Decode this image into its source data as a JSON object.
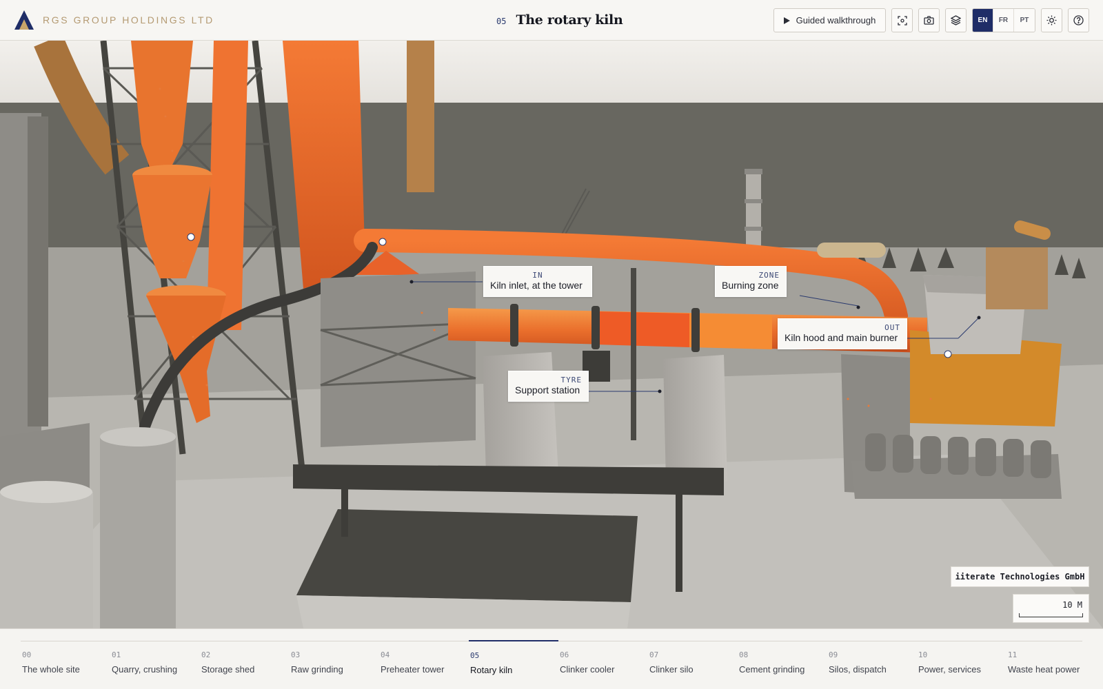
{
  "header": {
    "brand": "RGS GROUP HOLDINGS LTD",
    "section_number": "05",
    "title": "The rotary kiln",
    "walkthrough_label": "Guided walkthrough",
    "languages": [
      "EN",
      "FR",
      "PT"
    ],
    "active_language": "EN"
  },
  "labels": {
    "inlet": {
      "tag": "IN",
      "name": "Kiln inlet, at the tower"
    },
    "zone": {
      "tag": "ZONE",
      "name": "Burning zone"
    },
    "out": {
      "tag": "OUT",
      "name": "Kiln hood and main burner"
    },
    "tyre": {
      "tag": "TYRE",
      "name": "Support station"
    }
  },
  "credit": "iiterate Technologies GmbH",
  "scale": "10 M",
  "nav": [
    {
      "num": "00",
      "label": "The whole site"
    },
    {
      "num": "01",
      "label": "Quarry, crushing"
    },
    {
      "num": "02",
      "label": "Storage shed"
    },
    {
      "num": "03",
      "label": "Raw grinding"
    },
    {
      "num": "04",
      "label": "Preheater tower"
    },
    {
      "num": "05",
      "label": "Rotary kiln"
    },
    {
      "num": "06",
      "label": "Clinker cooler"
    },
    {
      "num": "07",
      "label": "Clinker silo"
    },
    {
      "num": "08",
      "label": "Cement grinding"
    },
    {
      "num": "09",
      "label": "Silos, dispatch"
    },
    {
      "num": "10",
      "label": "Power, services"
    },
    {
      "num": "11",
      "label": "Waste heat power"
    }
  ],
  "active_nav": "05",
  "colors": {
    "accent": "#1f2d67",
    "brand": "#b49a72",
    "kiln": "#e8672a"
  }
}
